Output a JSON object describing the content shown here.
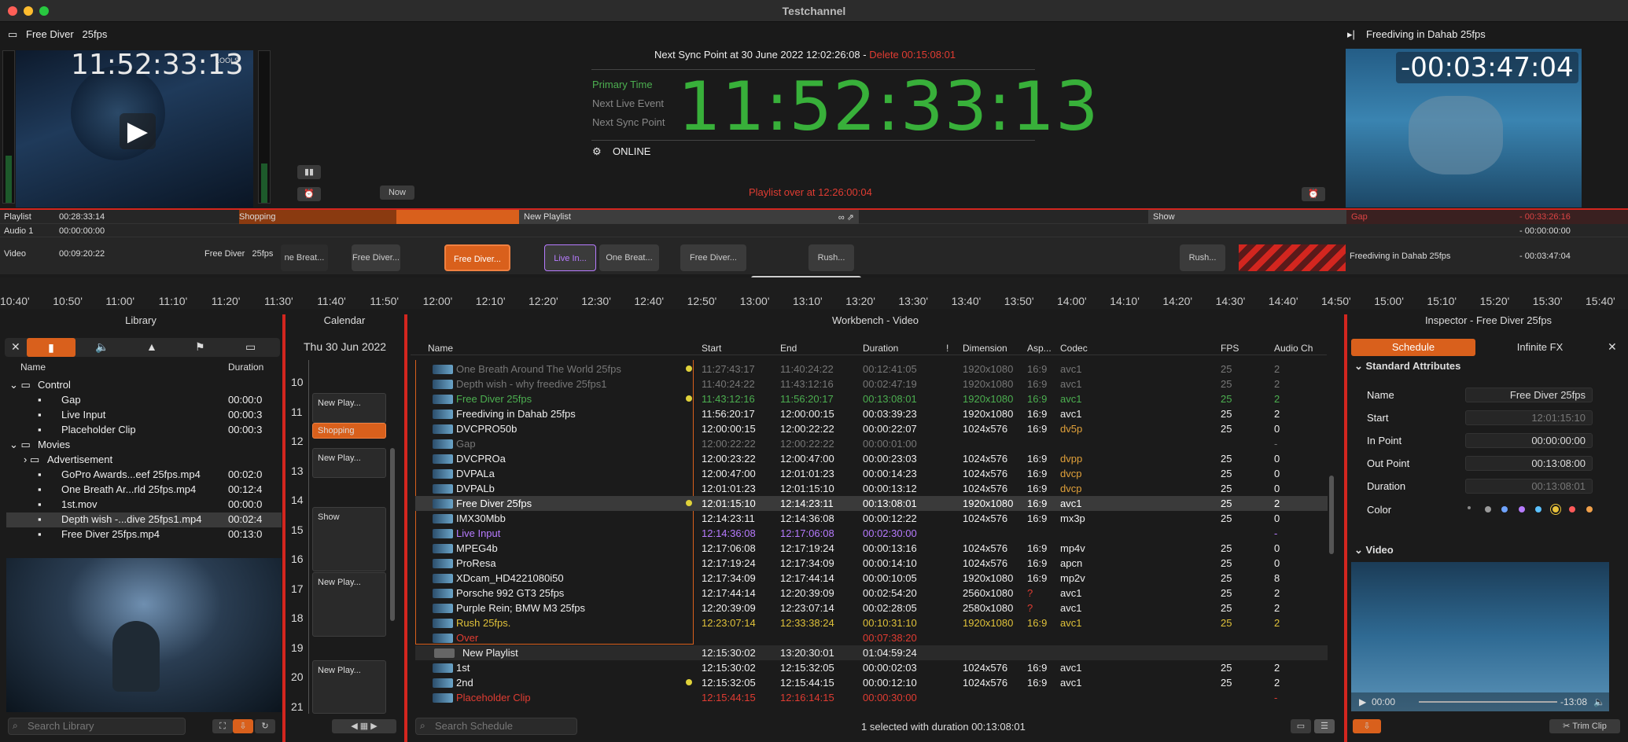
{
  "window": {
    "title": "Testchannel"
  },
  "left_preview": {
    "clip_name": "Free Diver",
    "fps": "25fps",
    "timecode": "11:52:33:13",
    "badge": "LOOLS"
  },
  "center": {
    "sync_text": "Next Sync Point at 30 June 2022 12:02:26:08 -",
    "delete_text": "Delete 00:15:08:01",
    "primary_time_label": "Primary Time",
    "next_live_label": "Next Live Event",
    "next_sync_label": "Next Sync Point",
    "big_time": "11:52:33:13",
    "status": "ONLINE",
    "playlist_over": "Playlist over at 12:26:00:04",
    "now_button": "Now"
  },
  "right_preview": {
    "clip_name": "Freediving in Dahab 25fps",
    "countdown": "-00:03:47:04"
  },
  "timeline": {
    "rows": [
      {
        "label": "Playlist",
        "time": "00:28:33:14"
      },
      {
        "label": "Audio 1",
        "time": "00:00:00:00"
      },
      {
        "label": "Video",
        "time": "00:09:20:22"
      }
    ],
    "video_clip_name": "Free Diver",
    "video_clip_fps": "25fps",
    "playlist_blocks": [
      "Shopping",
      "New Playlist",
      "Show",
      "Gap"
    ],
    "gap_time": "- 00:33:26:16",
    "audio_right_time": "- 00:00:00:00",
    "video_right_name": "Freediving in Dahab 25fps",
    "video_right_time": "- 00:03:47:04",
    "clips": [
      "ne Breat...",
      "Free Diver...",
      "Free Diver...",
      "Live In...",
      "One Breat...",
      "Free Diver...",
      "Rush...",
      "Rush..."
    ]
  },
  "ruler": [
    "10:40'",
    "10:50'",
    "11:00'",
    "11:10'",
    "11:20'",
    "11:30'",
    "11:40'",
    "11:50'",
    "12:00'",
    "12:10'",
    "12:20'",
    "12:30'",
    "12:40'",
    "12:50'",
    "13:00'",
    "13:10'",
    "13:20'",
    "13:30'",
    "13:40'",
    "13:50'",
    "14:00'",
    "14:10'",
    "14:20'",
    "14:30'",
    "14:40'",
    "14:50'",
    "15:00'",
    "15:10'",
    "15:20'",
    "15:30'",
    "15:40'"
  ],
  "library": {
    "title": "Library",
    "col_name": "Name",
    "col_duration": "Duration",
    "items": [
      {
        "name": "Control",
        "dur": "",
        "indent": 0
      },
      {
        "name": "Gap",
        "dur": "00:00:0",
        "indent": 2
      },
      {
        "name": "Live Input",
        "dur": "00:00:3",
        "indent": 2
      },
      {
        "name": "Placeholder Clip",
        "dur": "00:00:3",
        "indent": 2
      },
      {
        "name": "Movies",
        "dur": "",
        "indent": 0
      },
      {
        "name": "Advertisement",
        "dur": "",
        "indent": 1
      },
      {
        "name": "GoPro Awards...eef 25fps.mp4",
        "dur": "00:02:0",
        "indent": 2
      },
      {
        "name": "One Breath Ar...rld 25fps.mp4",
        "dur": "00:12:4",
        "indent": 2
      },
      {
        "name": "1st.mov",
        "dur": "00:00:0",
        "indent": 2
      },
      {
        "name": "Depth wish -...dive 25fps1.mp4",
        "dur": "00:02:4",
        "indent": 2
      },
      {
        "name": "Free Diver   25fps.mp4",
        "dur": "00:13:0",
        "indent": 2
      }
    ],
    "search_placeholder": "Search Library"
  },
  "calendar": {
    "title": "Calendar",
    "date": "Thu 30 Jun 2022",
    "hours": [
      "10",
      "11",
      "12",
      "13",
      "14",
      "15",
      "16",
      "17",
      "18",
      "19",
      "20",
      "21"
    ],
    "blocks": [
      "New Play...",
      "Shopping",
      "New Play...",
      "Show",
      "New Play...",
      "New Play..."
    ]
  },
  "workbench": {
    "title": "Workbench - Video",
    "columns": [
      "Name",
      "Start",
      "End",
      "Duration",
      "!",
      "Dimension",
      "Asp...",
      "Codec",
      "FPS",
      "Audio Ch"
    ],
    "rows": [
      [
        "One Breath Around The World 25fps",
        "11:27:43:17",
        "11:40:24:22",
        "00:12:41:05",
        "1920x1080",
        "16:9",
        "avc1",
        "25",
        "2",
        "dim"
      ],
      [
        "Depth wish - why freedive 25fps1",
        "11:40:24:22",
        "11:43:12:16",
        "00:02:47:19",
        "1920x1080",
        "16:9",
        "avc1",
        "25",
        "2",
        "dim"
      ],
      [
        "Free Diver   25fps",
        "11:43:12:16",
        "11:56:20:17",
        "00:13:08:01",
        "1920x1080",
        "16:9",
        "avc1",
        "25",
        "2",
        "green"
      ],
      [
        "Freediving in Dahab 25fps",
        "11:56:20:17",
        "12:00:00:15",
        "00:03:39:23",
        "1920x1080",
        "16:9",
        "avc1",
        "25",
        "2",
        "norm"
      ],
      [
        "DVCPRO50b",
        "12:00:00:15",
        "12:00:22:22",
        "00:00:22:07",
        "1024x576",
        "16:9",
        "dv5p",
        "25",
        "0",
        "norm"
      ],
      [
        "Gap",
        "12:00:22:22",
        "12:00:22:22",
        "00:00:01:00",
        "",
        "",
        "",
        "",
        "-",
        "dim"
      ],
      [
        "DVCPROa",
        "12:00:23:22",
        "12:00:47:00",
        "00:00:23:03",
        "1024x576",
        "16:9",
        "dvpp",
        "25",
        "0",
        "norm"
      ],
      [
        "DVPALa",
        "12:00:47:00",
        "12:01:01:23",
        "00:00:14:23",
        "1024x576",
        "16:9",
        "dvcp",
        "25",
        "0",
        "norm"
      ],
      [
        "DVPALb",
        "12:01:01:23",
        "12:01:15:10",
        "00:00:13:12",
        "1024x576",
        "16:9",
        "dvcp",
        "25",
        "0",
        "norm"
      ],
      [
        "Free Diver   25fps",
        "12:01:15:10",
        "12:14:23:11",
        "00:13:08:01",
        "1920x1080",
        "16:9",
        "avc1",
        "25",
        "2",
        "sel"
      ],
      [
        "IMX30Mbb",
        "12:14:23:11",
        "12:14:36:08",
        "00:00:12:22",
        "1024x576",
        "16:9",
        "mx3p",
        "25",
        "0",
        "norm"
      ],
      [
        "Live Input",
        "12:14:36:08",
        "12:17:06:08",
        "00:02:30:00",
        "",
        "",
        "",
        "",
        "-",
        "purple"
      ],
      [
        "MPEG4b",
        "12:17:06:08",
        "12:17:19:24",
        "00:00:13:16",
        "1024x576",
        "16:9",
        "mp4v",
        "25",
        "0",
        "norm"
      ],
      [
        "ProResa",
        "12:17:19:24",
        "12:17:34:09",
        "00:00:14:10",
        "1024x576",
        "16:9",
        "apcn",
        "25",
        "0",
        "norm"
      ],
      [
        "XDcam_HD4221080i50",
        "12:17:34:09",
        "12:17:44:14",
        "00:00:10:05",
        "1920x1080",
        "16:9",
        "mp2v",
        "25",
        "8",
        "norm"
      ],
      [
        "Porsche 992 GT3 25fps",
        "12:17:44:14",
        "12:20:39:09",
        "00:02:54:20",
        "2560x1080",
        "?",
        "avc1",
        "25",
        "2",
        "norm"
      ],
      [
        "Purple Rein; BMW M3   25fps",
        "12:20:39:09",
        "12:23:07:14",
        "00:02:28:05",
        "2580x1080",
        "?",
        "avc1",
        "25",
        "2",
        "norm"
      ],
      [
        "Rush  25fps.",
        "12:23:07:14",
        "12:33:38:24",
        "00:10:31:10",
        "1920x1080",
        "16:9",
        "avc1",
        "25",
        "2",
        "yellow"
      ],
      [
        "Over",
        "",
        "",
        "00:07:38:20",
        "",
        "",
        "",
        "",
        "",
        "red"
      ],
      [
        "New Playlist",
        "12:15:30:02",
        "13:20:30:01",
        "01:04:59:24",
        "",
        "",
        "",
        "",
        "",
        "group"
      ],
      [
        "1st",
        "12:15:30:02",
        "12:15:32:05",
        "00:00:02:03",
        "1024x576",
        "16:9",
        "avc1",
        "25",
        "2",
        "norm"
      ],
      [
        "2nd",
        "12:15:32:05",
        "12:15:44:15",
        "00:00:12:10",
        "1024x576",
        "16:9",
        "avc1",
        "25",
        "2",
        "norm"
      ],
      [
        "Placeholder Clip",
        "12:15:44:15",
        "12:16:14:15",
        "00:00:30:00",
        "",
        "",
        "",
        "",
        "-",
        "red"
      ]
    ],
    "search_placeholder": "Search Schedule",
    "status": "1 selected with duration 00:13:08:01"
  },
  "inspector": {
    "title": "Inspector - Free Diver   25fps",
    "tab_schedule": "Schedule",
    "tab_fx": "Infinite FX",
    "section_attrs": "Standard Attributes",
    "section_video": "Video",
    "name_label": "Name",
    "name_val": "Free Diver   25fps",
    "start_label": "Start",
    "start_val": "12:01:15:10",
    "in_label": "In Point",
    "in_val": "00:00:00:00",
    "out_label": "Out Point",
    "out_val": "00:13:08:00",
    "dur_label": "Duration",
    "dur_val": "00:13:08:01",
    "color_label": "Color",
    "colors": [
      "#888888",
      "#9a9a9a",
      "#6fa3ff",
      "#b77bff",
      "#5bc1ff",
      "#e8c23b",
      "#ff5a5a",
      "#f0a04a"
    ],
    "player_time": "00:00",
    "player_remaining": "-13:08",
    "trim_button": "Trim Clip"
  }
}
